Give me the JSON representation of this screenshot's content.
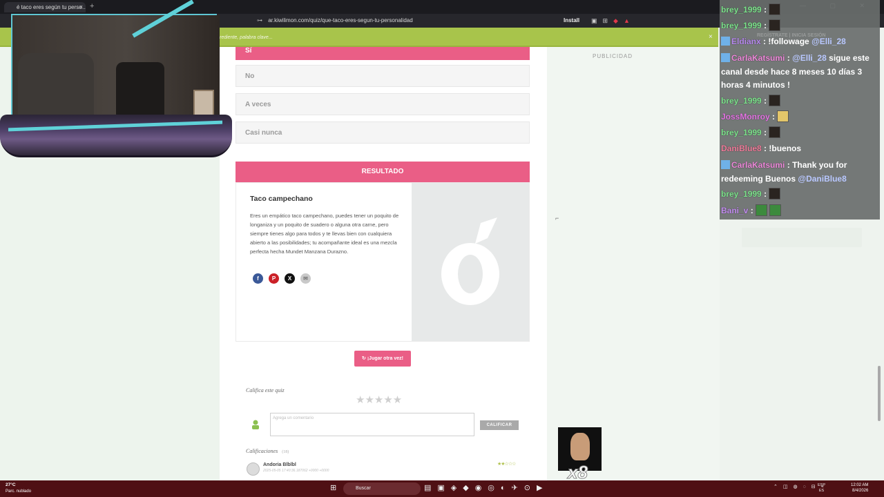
{
  "browser": {
    "tab_title": "é taco eres según tu perso…",
    "tab_close": "×",
    "new_tab": "+",
    "window_controls": "— ▢ ✕",
    "url": "ar.kiwilimon.com/quiz/que-taco-eres-segun-tu-personalidad",
    "install_label": "Install",
    "extension_icons": [
      "▣",
      "⊞"
    ]
  },
  "site": {
    "search_placeholder": "rediente, palabra clave...",
    "close_icon": "×",
    "register_label": "REGÍSTRATE | INICIA SESIÓN",
    "ad_label": "PUBLICIDAD",
    "accent_color": "#ea5e86",
    "brand_color": "#a8c44b"
  },
  "quiz": {
    "options": [
      "Sí",
      "No",
      "A veces",
      "Casi nunca"
    ],
    "selected_option": "Sí",
    "result_header": "RESULTADO",
    "result_title": "Taco campechano",
    "result_description": "Eres un empático taco campechano, puedes tener un poquito de longaniza y un poquito de suadero o alguna otra carne, pero siempre tienes algo para todos y te llevas bien con cualquiera abierto a las posibilidades; tu acompañante ideal es una mezcla perfecta hecha Mundet Manzana Durazno.",
    "share_icons": [
      "facebook-icon",
      "pinterest-icon",
      "x-icon",
      "mail-icon"
    ],
    "share_glyphs": {
      "facebook": "f",
      "pinterest": "P",
      "x": "X",
      "mail": "✉"
    },
    "replay_label": "¡Jugar otra vez!",
    "replay_icon": "↻",
    "rate_title": "Califica este quiz",
    "stars": "★★★★★",
    "comment_placeholder": "Agrega un comentario",
    "rate_button": "CALIFICAR",
    "ratings_title": "Calificaciones",
    "ratings_count": "(18)",
    "review": {
      "name": "Andoria Blblbl",
      "date": "2025-05-05 17:40:36.187062 +0000 +0000",
      "stars": "★★☆☆☆"
    }
  },
  "chat": {
    "register_text": "REGÍSTRATE | INICIA SESIÓN",
    "messages": [
      {
        "user": "brey_1999",
        "text": "",
        "emote": true
      },
      {
        "user": "brey_1999",
        "text": "",
        "emote": true
      },
      {
        "user": "Eldianx",
        "text": "!followage",
        "mention": "@Elli_28"
      },
      {
        "user": "CarlaKatsumi",
        "mention": "@Elli_28",
        "text": "sigue este canal desde hace 8 meses 10 días 3 horas 4 minutos !"
      },
      {
        "user": "brey_1999",
        "text": "",
        "emote": true
      },
      {
        "user": "JossMonroy",
        "text": "",
        "emote": true
      },
      {
        "user": "brey_1999",
        "text": "",
        "emote": true
      },
      {
        "user": "DaniBlue8",
        "text": "!buenos"
      },
      {
        "user": "CarlaKatsumi",
        "text": "Thank you for redeeming Buenos",
        "mention": "@DaniBlue8"
      },
      {
        "user": "brey_1999",
        "text": "",
        "emote": true
      },
      {
        "user": "Bani_v",
        "text": "",
        "emote": true
      }
    ],
    "separator": ":"
  },
  "sticker": {
    "count_label": "x8"
  },
  "taskbar": {
    "temperature": "27°C",
    "weather": "Parc. nublado",
    "search_label": "Buscar",
    "language_top": "ESP",
    "language_bottom": "ES",
    "time": "12:02 AM",
    "date": "8/4/2026"
  }
}
